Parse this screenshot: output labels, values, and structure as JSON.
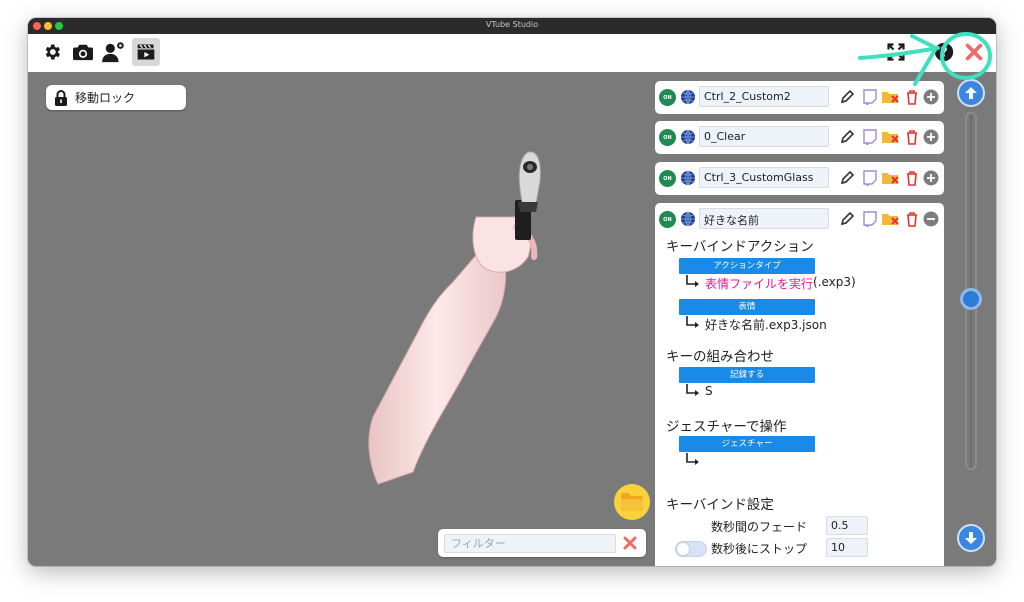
{
  "window": {
    "title": "VTube Studio"
  },
  "toolbar": {
    "icons": [
      "gear-icon",
      "camera-icon",
      "user-settings-icon",
      "clapperboard-icon"
    ],
    "right_icons": [
      "fullscreen-icon",
      "help-icon",
      "close-icon"
    ]
  },
  "viewport": {
    "lock_label": "移動ロック",
    "filter_placeholder": "フィルター"
  },
  "hotkeys": [
    {
      "state": "ON",
      "name": "Ctrl_2_Custom2"
    },
    {
      "state": "ON",
      "name": "0_Clear"
    },
    {
      "state": "ON",
      "name": "Ctrl_3_CustomGlass"
    },
    {
      "state": "ON",
      "name": "好きな名前"
    }
  ],
  "detail": {
    "keybind_action_title": "キーバインドアクション",
    "action_type_label": "アクションタイプ",
    "action_type_value": "表情ファイルを実行",
    "action_type_ext": " (.exp3)",
    "expression_label": "表情",
    "expression_value": "好きな名前.exp3.json",
    "key_combo_title": "キーの組み合わせ",
    "record_label": "記録する",
    "key_value": "S",
    "gesture_title": "ジェスチャーで操作",
    "gesture_label": "ジェスチャー",
    "gesture_value": "",
    "settings_title": "キーバインド設定",
    "fade_label": "数秒間のフェード",
    "fade_value": "0.5",
    "stop_label": "数秒後にストップ",
    "stop_value": "10",
    "stop_enabled": false
  },
  "colors": {
    "accent_blue": "#1a8ae8",
    "on_green": "#1f8a52",
    "action_magenta": "#e5159a",
    "annotation_teal": "#3fe0c0"
  }
}
